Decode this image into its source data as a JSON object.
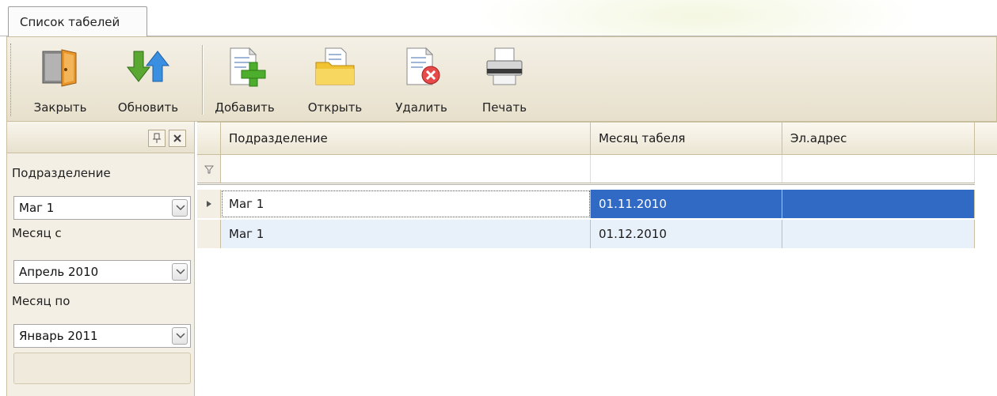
{
  "tab": {
    "title": "Список табелей"
  },
  "toolbar": {
    "close_label": "Закрыть",
    "refresh_label": "Обновить",
    "add_label": "Добавить",
    "open_label": "Открыть",
    "delete_label": "Удалить",
    "print_label": "Печать"
  },
  "filter_panel": {
    "pin_icon": "pin-icon",
    "close_icon": "close-icon",
    "department_label": "Подразделение",
    "department_value": "Маг 1",
    "month_from_label": "Месяц с",
    "month_from_value": "Апрель 2010",
    "month_to_label": "Месяц по",
    "month_to_value": "Январь 2011"
  },
  "grid": {
    "columns": [
      "Подразделение",
      "Месяц табеля",
      "Эл.адрес"
    ],
    "rows": [
      {
        "department": "Маг 1",
        "month": "01.11.2010",
        "email": "",
        "selected": true
      },
      {
        "department": "Маг 1",
        "month": "01.12.2010",
        "email": "",
        "selected": false
      }
    ]
  },
  "colors": {
    "selection": "#316ac5",
    "alt_row": "#e8f0fa",
    "toolbar_bg": "#ede7d6"
  }
}
